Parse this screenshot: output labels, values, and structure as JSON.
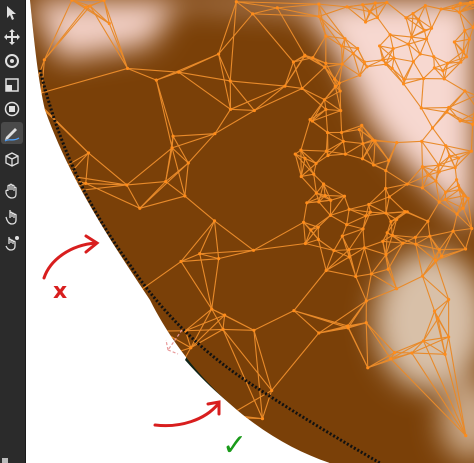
{
  "toolbar": {
    "tools": [
      {
        "name": "select-tool",
        "icon": "cursor-icon"
      },
      {
        "name": "move-tool",
        "icon": "move-arrows-icon"
      },
      {
        "name": "rotate-tool",
        "icon": "rotate-icon"
      },
      {
        "name": "scale-tool",
        "icon": "scale-icon"
      },
      {
        "name": "transform-tool",
        "icon": "transform-icon"
      },
      {
        "name": "annotate-tool",
        "icon": "pencil-icon"
      },
      {
        "name": "add-cube-tool",
        "icon": "cube-icon"
      },
      {
        "name": "grab-tool",
        "icon": "hand-icon"
      },
      {
        "name": "smooth-tool",
        "icon": "finger-icon"
      },
      {
        "name": "relax-tool",
        "icon": "finger-pinch-icon"
      }
    ],
    "active_index": 5
  },
  "annotations": {
    "wrong_mark": "x",
    "right_mark": "✓",
    "wrong_color": "#d81e1e",
    "right_color": "#1a9a1a"
  },
  "colors": {
    "mesh_fill": "#7a4008",
    "mesh_edge": "#e88a2a",
    "vertex": "#ff8c1a",
    "highlight": "#f7d8d0",
    "light_patch": "#d8c0a8",
    "shadow": "#0f2418"
  }
}
